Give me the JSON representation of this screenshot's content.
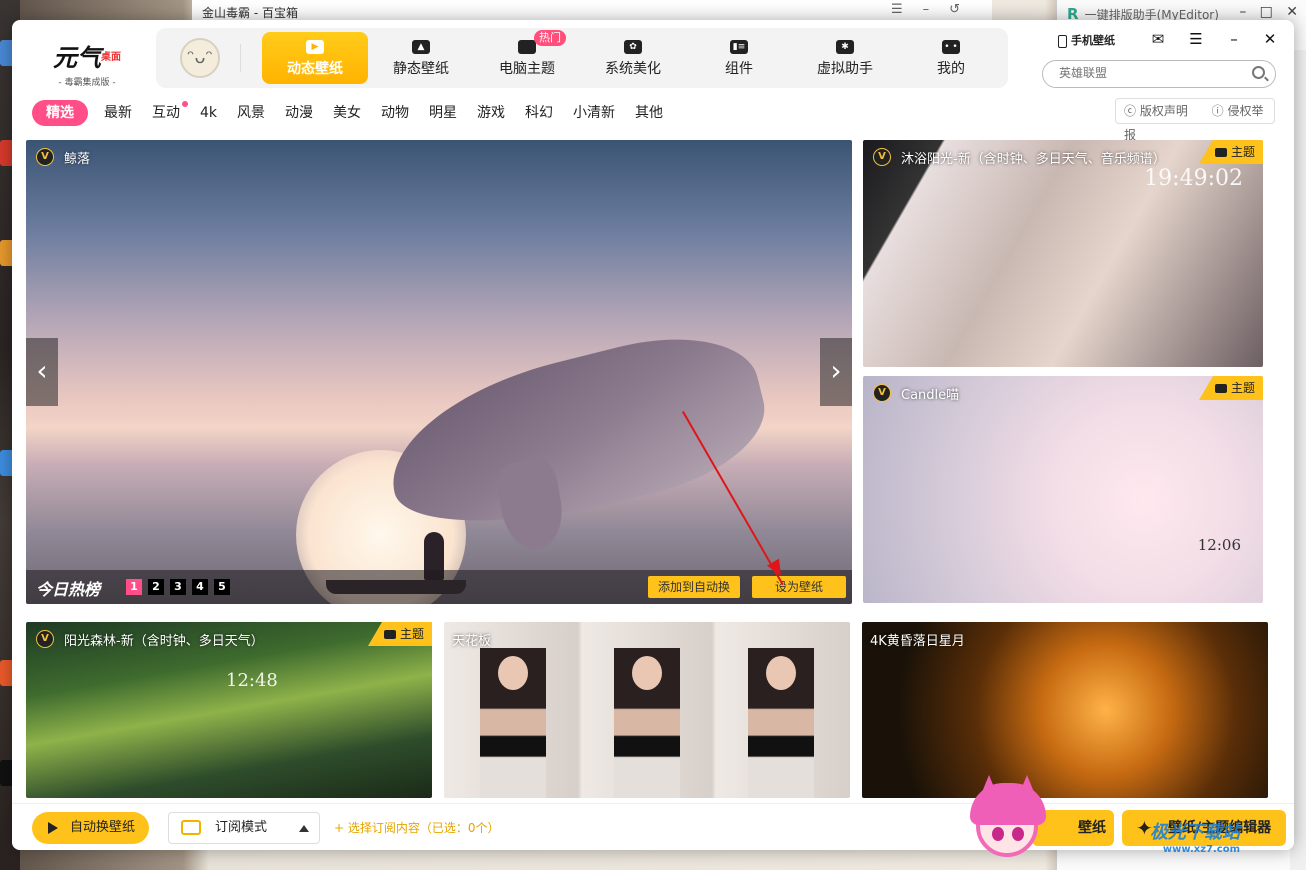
{
  "background": {
    "window1_title": "金山毒霸 - 百宝箱",
    "window2_title": "一键排版助手(MyEditor)"
  },
  "app": {
    "logo_main": "元气",
    "logo_tag": "桌面",
    "logo_sub": "- 毒霸集成版 -",
    "nav": [
      {
        "label": "动态壁纸",
        "icon": "video-icon",
        "active": true
      },
      {
        "label": "静态壁纸",
        "icon": "image-icon"
      },
      {
        "label": "电脑主题",
        "icon": "shirt-icon",
        "badge": "热门"
      },
      {
        "label": "系统美化",
        "icon": "flower-icon"
      },
      {
        "label": "组件",
        "icon": "widget-icon"
      },
      {
        "label": "虚拟助手",
        "icon": "paw-icon"
      },
      {
        "label": "我的",
        "icon": "user-icon"
      }
    ],
    "phone_wallpaper": "手机壁纸",
    "search_placeholder": "英雄联盟",
    "categories": [
      "精选",
      "最新",
      "互动",
      "4k",
      "风景",
      "动漫",
      "美女",
      "动物",
      "明星",
      "游戏",
      "科幻",
      "小清新",
      "其他"
    ],
    "copyright": "版权声明",
    "report": "侵权举报"
  },
  "hero": {
    "title": "鲸落",
    "hot_label": "今日热榜",
    "pages": [
      "1",
      "2",
      "3",
      "4",
      "5"
    ],
    "add_auto": "添加到自动换",
    "set_wallpaper": "设为壁纸"
  },
  "cards": [
    {
      "title": "沐浴阳光-新（含时钟、多日天气、音乐频谱）",
      "badge": "主题",
      "vip": true,
      "clock": "19:49:02"
    },
    {
      "title": "Candle喵",
      "badge": "主题",
      "vip": true,
      "clock": "12:06"
    },
    {
      "title": "阳光森林-新（含时钟、多日天气）",
      "badge": "主题",
      "vip": true,
      "clock": "12:48"
    },
    {
      "title": "天花板",
      "vip": false
    },
    {
      "title": "4K黄昏落日星月",
      "vip": false
    }
  ],
  "footer": {
    "auto_change": "自动换壁纸",
    "mode": "订阅模式",
    "subscribe": "+ 选择订阅内容（已选：0个）",
    "wallpaper_btn": "壁纸",
    "editor": "壁纸/主题编辑器"
  },
  "watermark": {
    "main": "极光下载站",
    "sub": "www.xz7.com"
  },
  "colors": {
    "accent": "#ffc21a",
    "pink": "#ff4e88",
    "arrow": "#e0151a"
  }
}
